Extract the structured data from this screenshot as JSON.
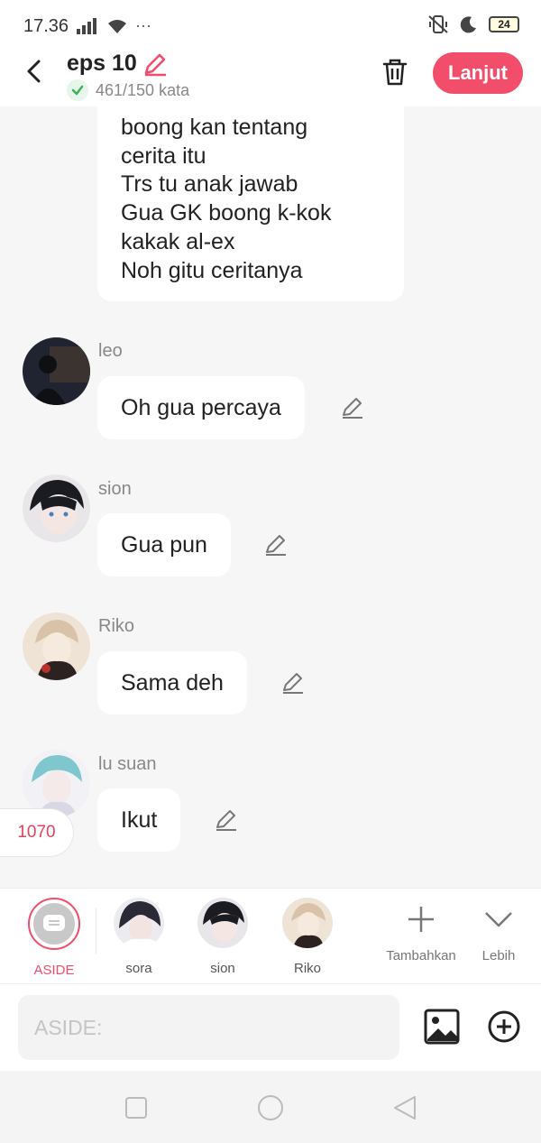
{
  "status_bar": {
    "time": "17.36",
    "dots": "···",
    "battery": "24"
  },
  "header": {
    "title": "eps 10",
    "word_count": "461/150 kata",
    "next_label": "Lanjut",
    "accent_color": "#f24d6b"
  },
  "first_message": {
    "lines": [
      "boong kan tentang",
      "cerita itu",
      "Trs tu anak jawab",
      "Gua GK boong k-kok",
      "kakak al-ex",
      "Noh gitu ceritanya"
    ]
  },
  "messages": [
    {
      "name": "leo",
      "text": "Oh gua percaya"
    },
    {
      "name": "sion",
      "text": "Gua pun"
    },
    {
      "name": "Riko",
      "text": "Sama deh"
    },
    {
      "name": "lu suan",
      "text": "Ikut"
    }
  ],
  "count_badge": "1070",
  "characters": [
    {
      "label": "ASIDE"
    },
    {
      "label": "sora"
    },
    {
      "label": "sion"
    },
    {
      "label": "Riko"
    }
  ],
  "tools": {
    "add_label": "Tambahkan",
    "more_label": "Lebih"
  },
  "input": {
    "placeholder": "ASIDE:",
    "value": ""
  }
}
